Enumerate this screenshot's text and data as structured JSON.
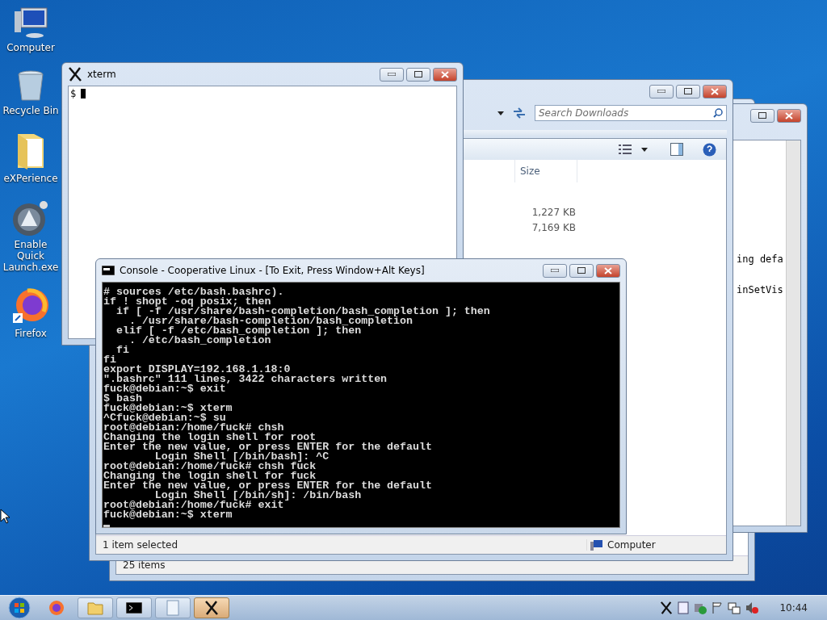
{
  "desktop_icons": [
    {
      "label": "Computer",
      "kind": "computer"
    },
    {
      "label": "Recycle Bin",
      "kind": "bin"
    },
    {
      "label": "eXPerience",
      "kind": "folder"
    },
    {
      "label": "Enable Quick Launch.exe",
      "kind": "app"
    },
    {
      "label": "Firefox",
      "kind": "firefox"
    }
  ],
  "notepad_window": {
    "lines": [
      "ing defa",
      "inSetVis"
    ]
  },
  "items_window": {
    "status": "25 items"
  },
  "explorer_window": {
    "search": {
      "placeholder": "Search Downloads"
    },
    "columns": [
      "Size"
    ],
    "sizes": [
      "1,227 KB",
      "7,169 KB"
    ],
    "status": "1 item selected",
    "location": "Computer"
  },
  "xterm_window": {
    "title": "xterm",
    "prompt": "$"
  },
  "console_window": {
    "title": "Console - Cooperative Linux - [To Exit, Press Window+Alt Keys]",
    "lines": [
      "# sources /etc/bash.bashrc).",
      "if ! shopt -oq posix; then",
      "  if [ -f /usr/share/bash-completion/bash_completion ]; then",
      "    . /usr/share/bash-completion/bash_completion",
      "  elif [ -f /etc/bash_completion ]; then",
      "    . /etc/bash_completion",
      "  fi",
      "fi",
      "export DISPLAY=192.168.1.18:0",
      "\".bashrc\" 111 lines, 3422 characters written",
      "fuck@debian:~$ exit",
      "$ bash",
      "fuck@debian:~$ xterm",
      "^Cfuck@debian:~$ su",
      "root@debian:/home/fuck# chsh",
      "Changing the login shell for root",
      "Enter the new value, or press ENTER for the default",
      "        Login Shell [/bin/bash]: ^C",
      "root@debian:/home/fuck# chsh fuck",
      "Changing the login shell for fuck",
      "Enter the new value, or press ENTER for the default",
      "        Login Shell [/bin/sh]: /bin/bash",
      "root@debian:/home/fuck# exit",
      "fuck@debian:~$ xterm"
    ]
  },
  "taskbar": {
    "buttons": [
      {
        "kind": "firefox",
        "selected": false
      },
      {
        "kind": "explorer",
        "selected": false
      },
      {
        "kind": "console",
        "selected": false
      },
      {
        "kind": "notepad",
        "selected": false
      },
      {
        "kind": "xterm",
        "selected": true
      }
    ],
    "clock": "10:44"
  }
}
